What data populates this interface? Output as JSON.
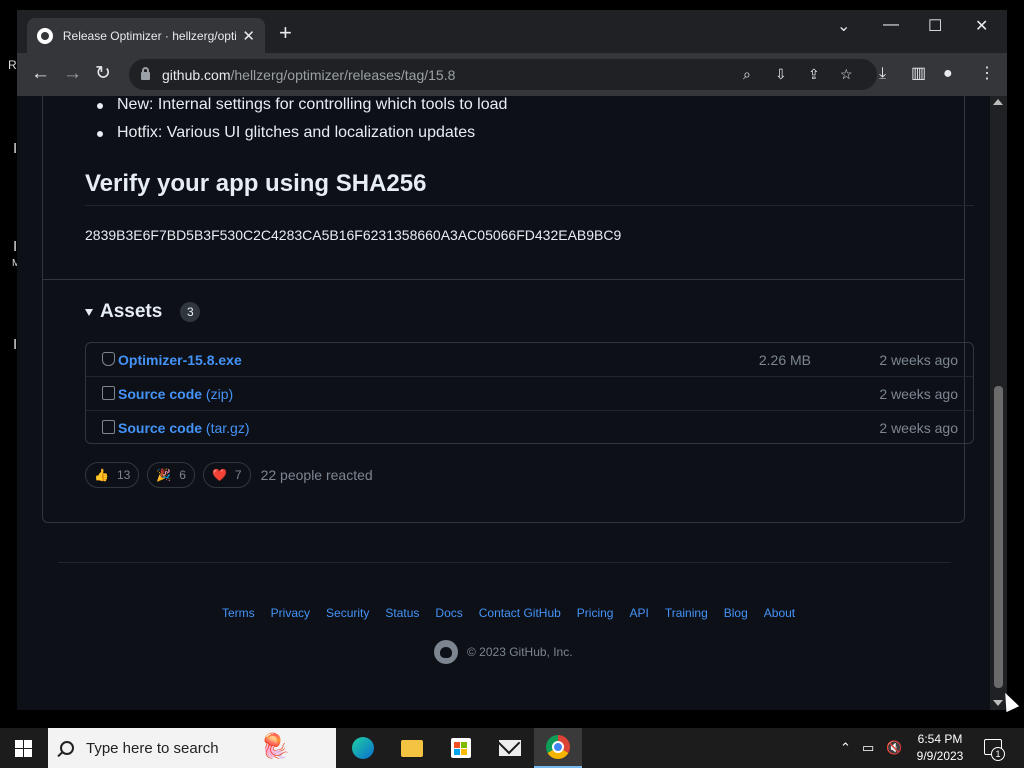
{
  "browser": {
    "tab_title": "Release Optimizer · hellzerg/opti",
    "tab_close": "✕",
    "new_tab": "+",
    "url_host": "github.com",
    "url_path": "/hellzerg/optimizer/releases/tag/15.8"
  },
  "release": {
    "notes": [
      "New: Internal settings for controlling which tools to load",
      "Hotfix: Various UI glitches and localization updates"
    ],
    "verify_heading": "Verify your app using SHA256",
    "sha256": "2839B3E6F7BD5B3F530C2C4283CA5B16F6231358660A3AC05066FD432EAB9BC9"
  },
  "assets": {
    "title": "Assets",
    "count": "3",
    "items": [
      {
        "name": "Optimizer-15.8.exe",
        "ext": "",
        "size": "2.26 MB",
        "date": "2 weeks ago",
        "icon": "package-icon"
      },
      {
        "name": "Source code",
        "ext": "(zip)",
        "size": "",
        "date": "2 weeks ago",
        "icon": "file-zip-icon"
      },
      {
        "name": "Source code",
        "ext": "(tar.gz)",
        "size": "",
        "date": "2 weeks ago",
        "icon": "file-zip-icon"
      }
    ]
  },
  "reactions": {
    "items": [
      {
        "emoji": "👍",
        "count": "13"
      },
      {
        "emoji": "🎉",
        "count": "6"
      },
      {
        "emoji": "❤️",
        "count": "7"
      }
    ],
    "summary": "22 people reacted"
  },
  "footer": {
    "links": [
      "Terms",
      "Privacy",
      "Security",
      "Status",
      "Docs",
      "Contact GitHub",
      "Pricing",
      "API",
      "Training",
      "Blog",
      "About"
    ],
    "copyright": "© 2023 GitHub, Inc."
  },
  "taskbar": {
    "search_placeholder": "Type here to search",
    "time": "6:54 PM",
    "date": "9/9/2023",
    "notifications": "1"
  },
  "desktop": {
    "fragments": [
      "Re",
      "I",
      "I",
      "M",
      "I"
    ]
  },
  "colors": {
    "page_bg": "#0d1117",
    "link": "#4493f8",
    "muted": "#7d8590",
    "border": "#30363d"
  }
}
